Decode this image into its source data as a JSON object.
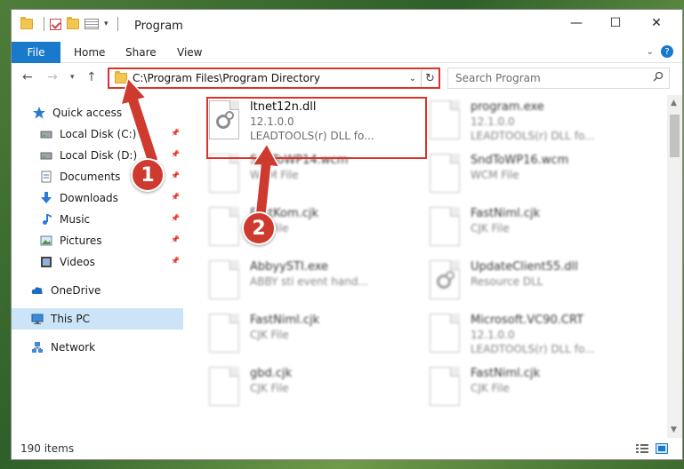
{
  "window": {
    "title": "Program"
  },
  "ribbon": {
    "file": "File",
    "tabs": [
      "Home",
      "Share",
      "View"
    ]
  },
  "address": {
    "path": "C:\\Program Files\\Program Directory"
  },
  "search": {
    "placeholder": "Search Program"
  },
  "nav": {
    "items": [
      {
        "label": "Quick access",
        "icon": "star-icon",
        "pinned": false
      },
      {
        "label": "Local Disk (C:)",
        "icon": "drive-icon",
        "pinned": true
      },
      {
        "label": "Local Disk (D:)",
        "icon": "drive-icon",
        "pinned": true
      },
      {
        "label": "Documents",
        "icon": "documents-icon",
        "pinned": true
      },
      {
        "label": "Downloads",
        "icon": "download-icon",
        "pinned": true
      },
      {
        "label": "Music",
        "icon": "music-icon",
        "pinned": true
      },
      {
        "label": "Pictures",
        "icon": "pictures-icon",
        "pinned": true
      },
      {
        "label": "Videos",
        "icon": "videos-icon",
        "pinned": true
      },
      {
        "label": "OneDrive",
        "icon": "cloud-icon",
        "pinned": false
      },
      {
        "label": "This PC",
        "icon": "computer-icon",
        "pinned": false,
        "selected": true
      },
      {
        "label": "Network",
        "icon": "network-icon",
        "pinned": false
      }
    ]
  },
  "files": [
    {
      "name": "ltnet12n.dll",
      "line2": "12.1.0.0",
      "line3": "LEADTOOLS(r) DLL fo...",
      "highlighted": true
    },
    {
      "name": "program.exe",
      "line2": "12.1.0.0",
      "line3": "LEADTOOLS(r) DLL fo...",
      "blurred": true
    },
    {
      "name": "SndToWP14.wcm",
      "line2": "WCM File",
      "line3": "",
      "blurred": true
    },
    {
      "name": "SndToWP16.wcm",
      "line2": "WCM File",
      "line3": "",
      "blurred": true
    },
    {
      "name": "FastKom.cjk",
      "line2": "CJK File",
      "line3": "",
      "blurred": true
    },
    {
      "name": "FastNiml.cjk",
      "line2": "CJK File",
      "line3": "",
      "blurred": true
    },
    {
      "name": "AbbyySTI.exe",
      "line2": "ABBY sti event hand...",
      "line3": "",
      "blurred": true
    },
    {
      "name": "UpdateClient55.dll",
      "line2": "Resource DLL",
      "line3": "",
      "blurred": true
    },
    {
      "name": "FastNiml.cjk",
      "line2": "CJK File",
      "line3": "",
      "blurred": true
    },
    {
      "name": "Microsoft.VC90.CRT",
      "line2": "12.1.0.0",
      "line3": "LEADTOOLS(r) DLL fo...",
      "blurred": true
    },
    {
      "name": "gbd.cjk",
      "line2": "CJK File",
      "line3": "",
      "blurred": true
    },
    {
      "name": "FastNiml.cjk",
      "line2": "CJK File",
      "line3": "",
      "blurred": true
    }
  ],
  "status": {
    "count": "190 items"
  },
  "annotations": {
    "badge1": "1",
    "badge2": "2"
  },
  "colors": {
    "accent": "#1979ca",
    "highlight": "#d9342b",
    "selected": "#cce4f7"
  }
}
